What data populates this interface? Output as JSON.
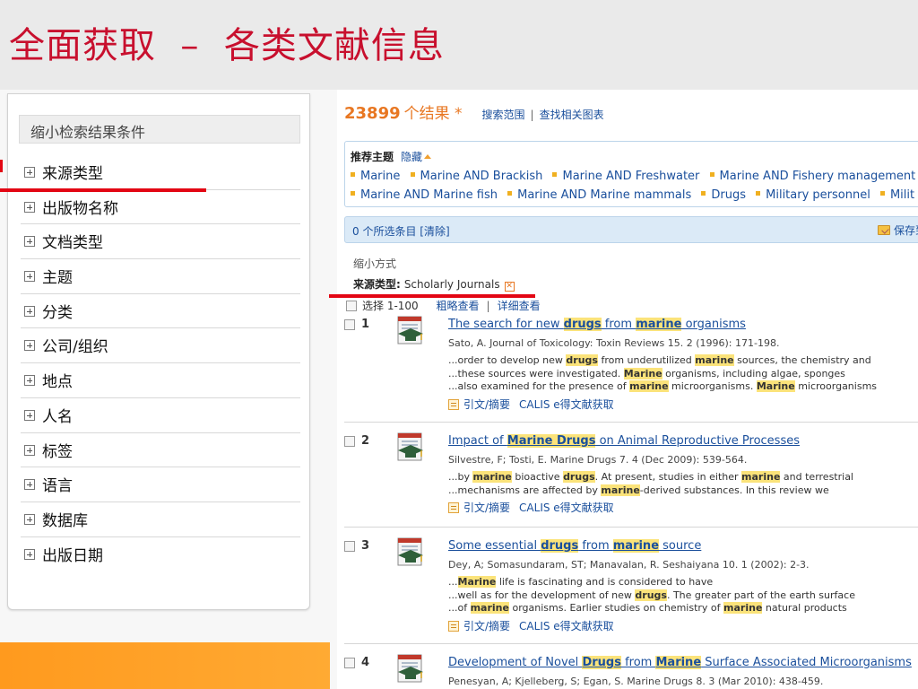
{
  "slide": {
    "title": "全面获取  –  各类文献信息"
  },
  "facets": {
    "header": "缩小检索结果条件",
    "items": [
      "来源类型",
      "出版物名称",
      "文档类型",
      "主题",
      "分类",
      "公司/组织",
      "地点",
      "人名",
      "标签",
      "语言",
      "数据库",
      "出版日期"
    ]
  },
  "results": {
    "count": "23899",
    "count_label": "个结果 *",
    "scope_link": "搜索范围",
    "charts_link": "查找相关图表",
    "topics": {
      "title": "推荐主题",
      "hide": "隐藏",
      "row1": [
        "Marine",
        "Marine AND Brackish",
        "Marine AND Freshwater",
        "Marine AND Fishery management"
      ],
      "row2": [
        "Marine AND Marine fish",
        "Marine AND Marine mammals",
        "Drugs",
        "Military personnel",
        "Milit"
      ]
    },
    "selected_bar": {
      "text": "0 个所选条目 [清除]",
      "save": "保存到"
    },
    "narrow": {
      "label": "缩小方式",
      "key": "来源类型:",
      "value": "Scholarly Journals"
    },
    "select_row": {
      "select": "选择 1-100",
      "brief": "粗略查看",
      "detail": "详细查看"
    },
    "link_citation": "引文/摘要",
    "link_calis": "CALIS e得文献获取"
  },
  "records": [
    {
      "num": "1",
      "title": [
        "The search for new ",
        "drugs",
        " from ",
        "marine",
        " organisms"
      ],
      "meta": "Sato, A. Journal of Toxicology: Toxin Reviews 15. 2 (1996): 171-198.",
      "snippets": [
        [
          "...order to develop new ",
          "drugs",
          " from underutilized ",
          "marine",
          " sources, the chemistry and"
        ],
        [
          "...these sources were investigated. ",
          "Marine",
          " organisms, including algae, sponges"
        ],
        [
          "...also examined for the presence of ",
          "marine",
          " microorganisms. ",
          "Marine",
          " microorganisms"
        ]
      ]
    },
    {
      "num": "2",
      "title": [
        "Impact of ",
        "Marine Drugs",
        " on Animal Reproductive Processes"
      ],
      "meta": "Silvestre, F; Tosti, E. Marine Drugs 7. 4 (Dec 2009): 539-564.",
      "snippets": [
        [
          "...by ",
          "marine",
          " bioactive ",
          "drugs",
          ". At present, studies in either ",
          "marine",
          " and terrestrial"
        ],
        [
          "...mechanisms are affected by ",
          "marine",
          "-derived substances. In this review we"
        ]
      ]
    },
    {
      "num": "3",
      "title": [
        "Some essential ",
        "drugs",
        " from ",
        "marine",
        " source"
      ],
      "meta": "Dey, A; Somasundaram, ST; Manavalan, R. Seshaiyana 10. 1 (2002): 2-3.",
      "snippets": [
        [
          "...",
          "Marine",
          " life is fascinating and is considered to have"
        ],
        [
          "...well as for the development of new ",
          "drugs",
          ". The greater part of the earth surface"
        ],
        [
          "...of ",
          "marine",
          " organisms. Earlier studies on chemistry of ",
          "marine",
          " natural products"
        ]
      ]
    },
    {
      "num": "4",
      "title": [
        "Development of Novel ",
        "Drugs",
        " from ",
        "Marine",
        " Surface Associated Microorganisms"
      ],
      "meta": "Penesyan, A; Kjelleberg, S; Egan, S. Marine Drugs 8. 3 (Mar 2010): 438-459.",
      "snippets": []
    }
  ],
  "colors": {
    "title_red": "#c8102e",
    "accent_orange": "#e87722",
    "link_blue": "#1a4f9c",
    "highlight": "#fbe37a",
    "annotation_red": "#e30613"
  },
  "icons": [
    "plus-box-icon",
    "folder-icon",
    "remove-x-icon",
    "document-icon",
    "note-icon",
    "caret-up-icon"
  ]
}
